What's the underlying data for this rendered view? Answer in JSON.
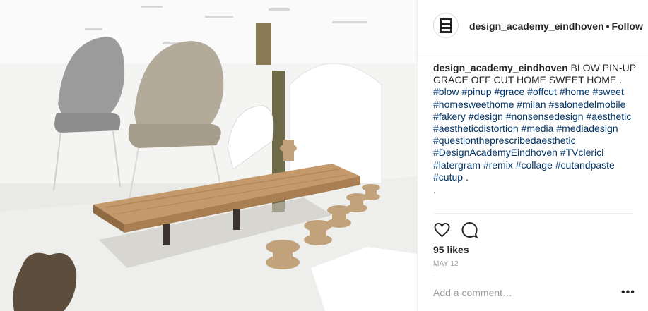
{
  "post": {
    "username": "design_academy_eindhoven",
    "header_separator": "•",
    "follow_label": "Follow",
    "caption_text": "BLOW PIN-UP GRACE OFF CUT HOME SWEET HOME .",
    "hashtags": [
      "#blow",
      "#pinup",
      "#grace",
      "#offcut",
      "#home",
      "#sweet",
      "#homesweethome",
      "#milan",
      "#salonedelmobile",
      "#fakery",
      "#design",
      "#nonsensedesign",
      "#aesthetic",
      "#aestheticdistortion",
      "#media",
      "#mediadesign",
      "#questiontheprescribedaesthetic",
      "#DesignAcademyEindhoven",
      "#TVclerici",
      "#latergram",
      "#remix",
      "#collage",
      "#cutandpaste",
      "#cutup"
    ],
    "caption_end": ".",
    "caption_extra_line": ".",
    "likes_label": "95 likes",
    "date": "MAY 12",
    "comment_placeholder": "Add a comment…",
    "more_options": "•••"
  },
  "icons": {
    "like": "heart-icon",
    "comment": "comment-bubble-icon",
    "avatar": "design-academy-logo-icon"
  },
  "colors": {
    "hashtag": "#003569",
    "text": "#262626",
    "muted": "#999999",
    "border": "#efefef"
  }
}
